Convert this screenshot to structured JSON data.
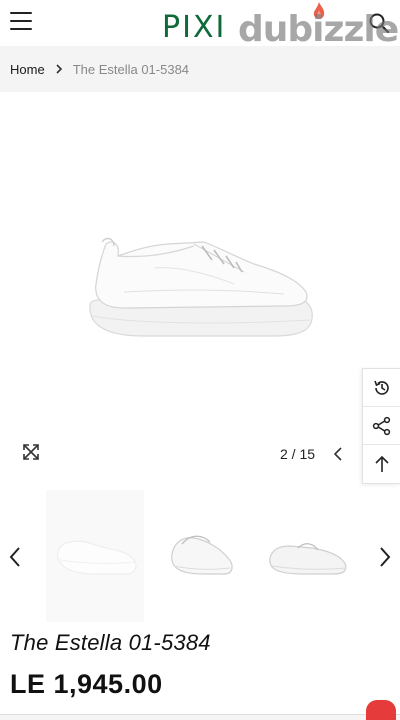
{
  "header": {
    "logo_text": "PIXI",
    "menu_icon": "hamburger-icon",
    "search_icon": "search-icon",
    "brand_color": "#0f6a3a"
  },
  "watermark": {
    "text": "dubizzle",
    "flame_color": "#e8432b"
  },
  "breadcrumb": {
    "home": "Home",
    "separator_icon": "chevron-right-icon",
    "current": "The Estella 01-5384"
  },
  "gallery": {
    "pager": "2 / 15",
    "zoom_icon": "expand-icon",
    "prev_icon": "chevron-left-icon"
  },
  "side_actions": [
    {
      "name": "history-icon"
    },
    {
      "name": "share-icon"
    },
    {
      "name": "arrow-up-icon"
    }
  ],
  "thumbnails": {
    "prev_icon": "chevron-left-icon",
    "next_icon": "chevron-right-icon"
  },
  "product": {
    "title": "The Estella 01-5384",
    "price": "LE 1,945.00"
  }
}
